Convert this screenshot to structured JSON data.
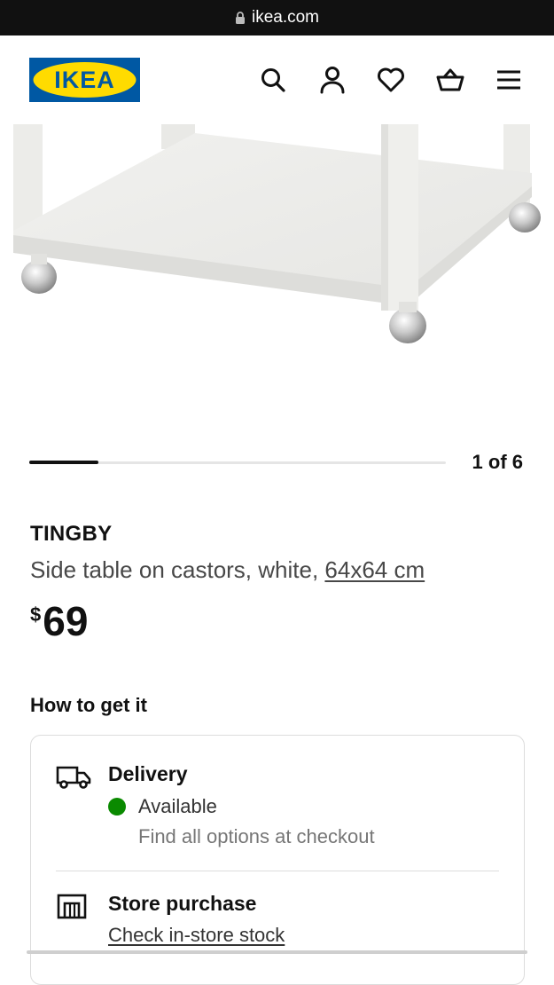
{
  "browser": {
    "url": "ikea.com"
  },
  "header": {
    "logo_text": "IKEA",
    "brand_colors": {
      "blue": "#0058A3",
      "yellow": "#FFDB00"
    },
    "icons": [
      "search-icon",
      "profile-icon",
      "heart-icon",
      "shopping-bag-icon",
      "menu-icon"
    ]
  },
  "gallery": {
    "counter": "1 of 6",
    "current": 1,
    "total": 6
  },
  "product": {
    "name": "TINGBY",
    "description": "Side table on castors, white,",
    "dimensions": "64x64 cm",
    "currency": "$",
    "price": "69"
  },
  "availability": {
    "heading": "How to get it",
    "delivery": {
      "title": "Delivery",
      "status": "Available",
      "status_color": "#0A8A00",
      "note": "Find all options at checkout"
    },
    "store": {
      "title": "Store purchase",
      "link": "Check in-store stock"
    }
  }
}
